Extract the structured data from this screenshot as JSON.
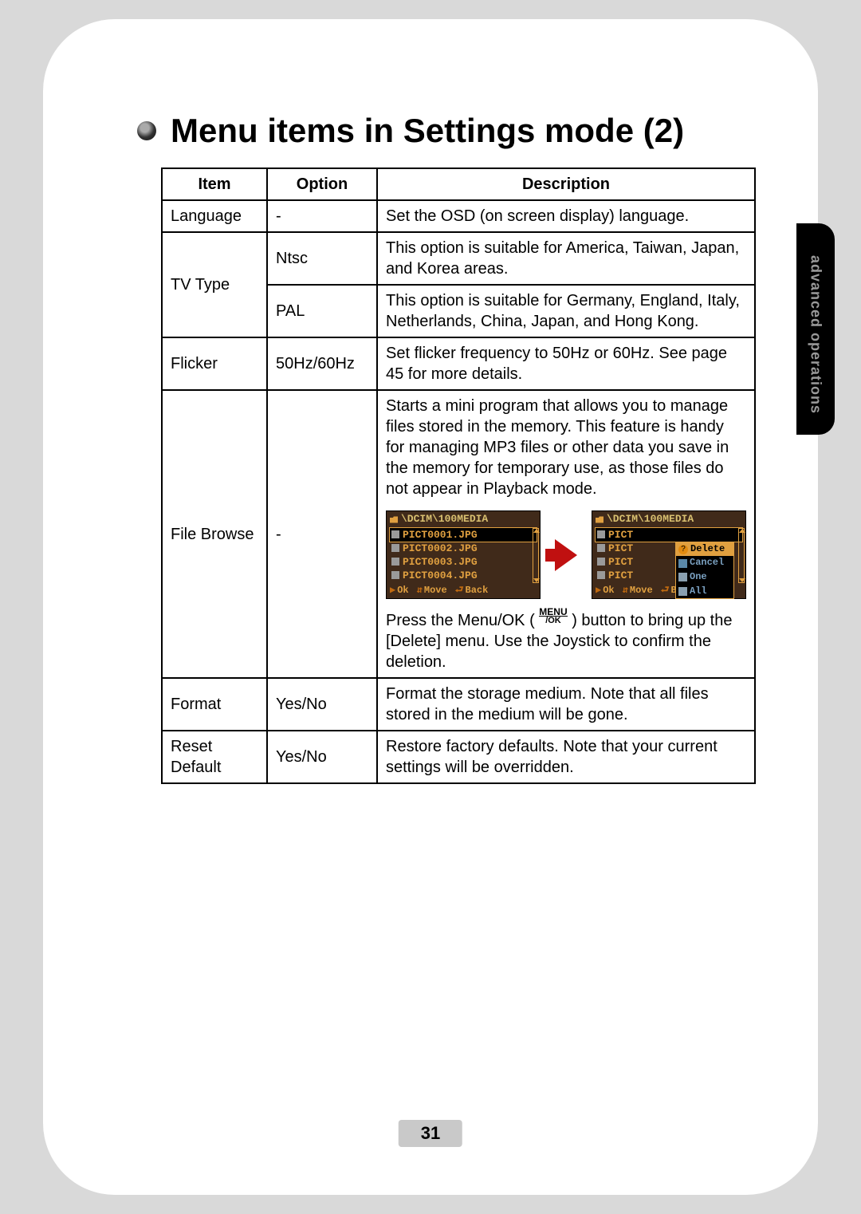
{
  "side_tab": "advanced operations",
  "heading": "Menu items in Settings mode (2)",
  "page_number": "31",
  "table": {
    "headers": {
      "item": "Item",
      "option": "Option",
      "description": "Description"
    },
    "language": {
      "item": "Language",
      "option": "-",
      "desc": "Set the OSD (on screen display) language."
    },
    "tvtype": {
      "item": "TV Type",
      "ntsc": {
        "option": "Ntsc",
        "desc": "This option is suitable for America, Taiwan, Japan, and Korea areas."
      },
      "pal": {
        "option": "PAL",
        "desc": "This option is suitable for Germany, England, Italy, Netherlands, China, Japan, and Hong Kong."
      }
    },
    "flicker": {
      "item": "Flicker",
      "option": "50Hz/60Hz",
      "desc": "Set flicker frequency to 50Hz or 60Hz. See page 45 for more details."
    },
    "filebrowse": {
      "item": "File Browse",
      "option": "-",
      "desc_top": "Starts a mini program that allows you to manage files stored in the memory. This feature is handy for managing MP3 files or other data you save in the memory for temporary use, as those files do not appear in Playback mode.",
      "desc_btn_pre": "Press the Menu/OK ( ",
      "desc_btn_post": ") button to bring up the [Delete] menu. Use the Joystick to confirm the deletion.",
      "menu_ok_top": "MENU",
      "menu_ok_bot": "/OK",
      "screen": {
        "path": "\\DCIM\\100MEDIA",
        "files": [
          "PICT0001.JPG",
          "PICT0002.JPG",
          "PICT0003.JPG",
          "PICT0004.JPG"
        ],
        "files_short": [
          "PICT",
          "PICT",
          "PICT",
          "PICT"
        ],
        "foot_ok": "Ok",
        "foot_move": "Move",
        "foot_back": "Back",
        "menu": {
          "delete": "Delete",
          "cancel": "Cancel",
          "one": "One",
          "all": "All"
        }
      }
    },
    "format": {
      "item": "Format",
      "option": "Yes/No",
      "desc": "Format the storage medium. Note that all files stored in the medium will be gone."
    },
    "reset": {
      "item": "Reset Default",
      "option": "Yes/No",
      "desc": "Restore factory defaults. Note that your current settings will be overridden."
    }
  }
}
